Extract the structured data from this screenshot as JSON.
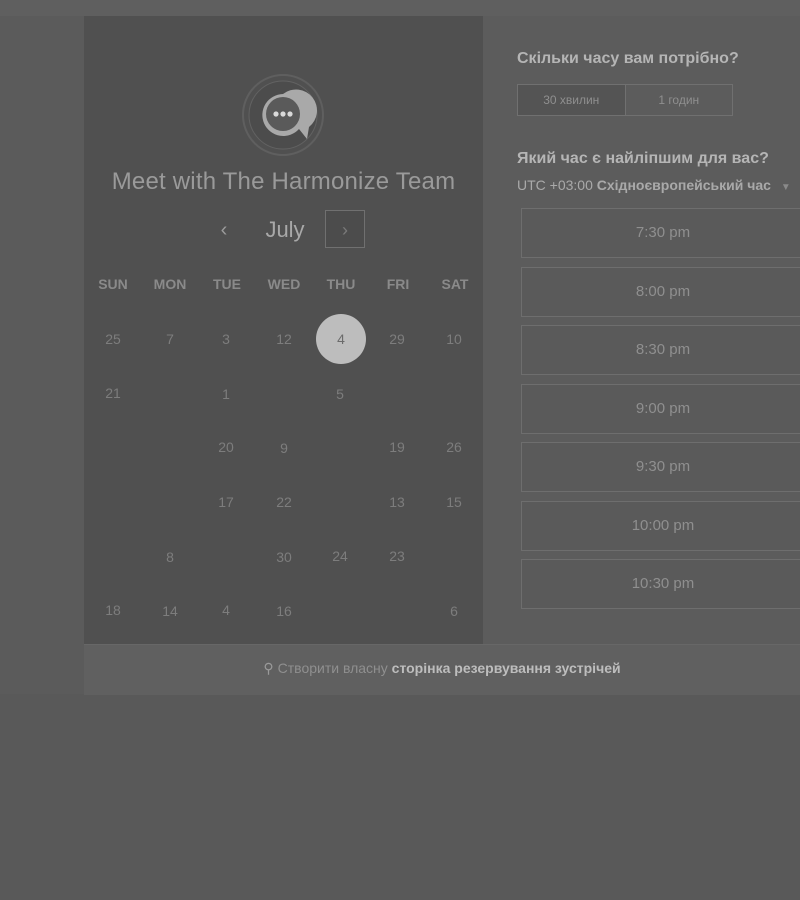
{
  "page": {
    "title": "Meet with The Harmonize Team",
    "month": "July",
    "prev_glyph": "‹",
    "next_glyph": "›"
  },
  "calendar": {
    "weekdays": [
      "SUN",
      "MON",
      "TUE",
      "WED",
      "THU",
      "FRI",
      "SAT"
    ],
    "selected_day": "4",
    "rows": [
      [
        "25",
        "7",
        "3",
        "12",
        "4",
        "29",
        "10"
      ],
      [
        "21",
        "",
        "1",
        "",
        "5",
        "",
        ""
      ],
      [
        "",
        "",
        "20",
        "9",
        "",
        "19",
        "26"
      ],
      [
        "",
        "",
        "17",
        "22",
        "",
        "13",
        "15"
      ],
      [
        "",
        "8",
        "",
        "30",
        "24",
        "23",
        ""
      ],
      [
        "18",
        "14",
        "4",
        "16",
        "",
        "",
        "6"
      ]
    ]
  },
  "duration": {
    "question": "Скільки часу вам потрібно?",
    "options": [
      "30 хвилин",
      "1 годин"
    ],
    "selected": "30 хвилин"
  },
  "time": {
    "question": "Який час є найліпшим для вас?",
    "timezone_offset": "UTC +03:00",
    "timezone_name": "Східноєвропейський час",
    "slots": [
      "7:30 pm",
      "8:00 pm",
      "8:30 pm",
      "9:00 pm",
      "9:30 pm",
      "10:00 pm",
      "10:30 pm"
    ]
  },
  "footer": {
    "prefix": "Створити власну",
    "link": "сторінка резервування зустрічей"
  },
  "colors": {
    "selected_day_bg": "#bdbdbd",
    "panel_dark": "#505050",
    "panel_light": "#5c5c5c"
  }
}
